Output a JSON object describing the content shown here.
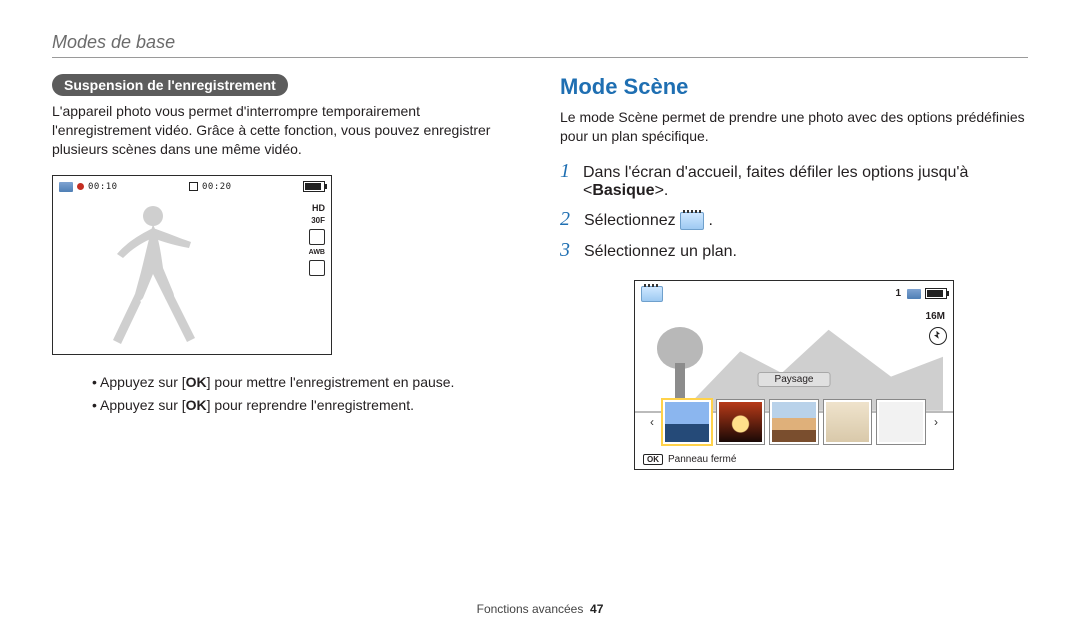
{
  "header": {
    "section_title": "Modes de base"
  },
  "left": {
    "pill": "Suspension de l'enregistrement",
    "para": "L'appareil photo vous permet d'interrompre temporairement l'enregistrement vidéo. Grâce à cette fonction, vous pouvez enregistrer plusieurs scènes dans une même vidéo.",
    "screen": {
      "elapsed": "00:10",
      "remaining": "00:20",
      "hd": "HD",
      "fps": "30F",
      "awb": "AWB"
    },
    "bullets": [
      {
        "pre": "Appuyez sur [",
        "ok": "OK",
        "post": "] pour mettre l'enregistrement en pause."
      },
      {
        "pre": "Appuyez sur [",
        "ok": "OK",
        "post": "] pour reprendre l'enregistrement."
      }
    ]
  },
  "right": {
    "title": "Mode Scène",
    "para": "Le mode Scène permet de prendre une photo avec des options prédéfinies pour un plan spécifique.",
    "steps": {
      "s1_pre": "Dans l'écran d'accueil, faites défiler les options jusqu'à <",
      "s1_bold": "Basique",
      "s1_post": ">.",
      "s2": "Sélectionnez ",
      "s3": "Sélectionnez un plan."
    },
    "screen": {
      "counter": "1",
      "res": "16M",
      "label": "Paysage",
      "panel_ok": "OK",
      "panel_text": "Panneau fermé"
    }
  },
  "footer": {
    "label": "Fonctions avancées",
    "page": "47"
  }
}
